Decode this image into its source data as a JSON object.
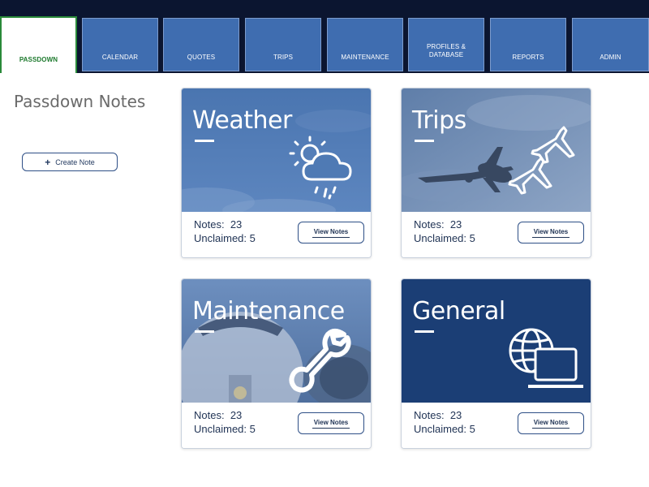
{
  "nav": {
    "tabs": [
      {
        "label": "PASSDOWN",
        "active": true
      },
      {
        "label": "CALENDAR"
      },
      {
        "label": "QUOTES"
      },
      {
        "label": "TRIPS"
      },
      {
        "label": "MAINTENANCE"
      },
      {
        "label_line1": "PROFILES &",
        "label_line2": "DATABASE"
      },
      {
        "label": "REPORTS"
      },
      {
        "label": "ADMIN"
      }
    ]
  },
  "page": {
    "title": "Passdown Notes",
    "create_button": {
      "icon": "plus-icon",
      "label": "Create Note"
    }
  },
  "cards": [
    {
      "title": "Weather",
      "icon": "weather-icon",
      "notes_label": "Notes:",
      "notes_value": "23",
      "unclaimed_label": "Unclaimed:",
      "unclaimed_value": "5",
      "button": "View Notes"
    },
    {
      "title": "Trips",
      "icon": "airplanes-icon",
      "notes_label": "Notes:",
      "notes_value": "23",
      "unclaimed_label": "Unclaimed:",
      "unclaimed_value": "5",
      "button": "View Notes"
    },
    {
      "title": "Maintenance",
      "icon": "wrench-icon",
      "notes_label": "Notes:",
      "notes_value": "23",
      "unclaimed_label": "Unclaimed:",
      "unclaimed_value": "5",
      "button": "View Notes"
    },
    {
      "title": "General",
      "icon": "globe-laptop-icon",
      "notes_label": "Notes:",
      "notes_value": "23",
      "unclaimed_label": "Unclaimed:",
      "unclaimed_value": "5",
      "button": "View Notes"
    }
  ],
  "colors": {
    "topbar": "#0b1530",
    "tab": "#3f6db0",
    "active_tab_text": "#1e7a2e",
    "card_general": "#1b3e75",
    "text_dark": "#223556"
  }
}
